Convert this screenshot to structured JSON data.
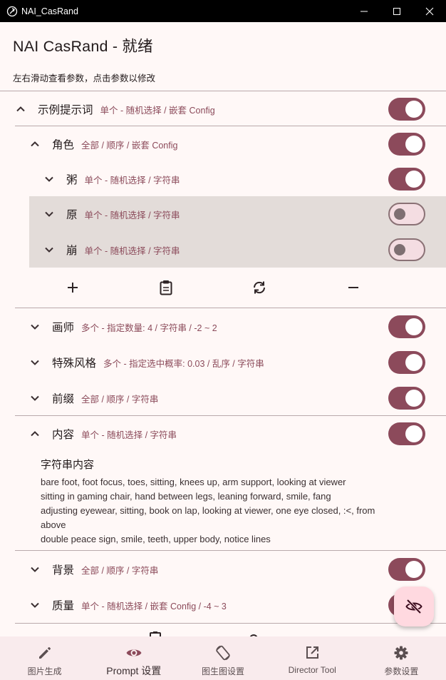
{
  "window": {
    "title": "NAI_CasRand",
    "minimize_icon": "minimize-icon",
    "maximize_icon": "maximize-icon",
    "close_icon": "close-icon"
  },
  "header": {
    "title": "NAI CasRand - 就绪",
    "hint": "左右滑动查看参数，点击参数以修改"
  },
  "tree": {
    "root": {
      "title": "示例提示词",
      "desc": "单个 - 随机选择 / 嵌套 Config",
      "expanded": true,
      "enabled": true
    },
    "role": {
      "title": "角色",
      "desc": "全部 / 顺序 / 嵌套 Config",
      "expanded": true,
      "enabled": true
    },
    "role_children": [
      {
        "title": "粥",
        "desc": "单个 - 随机选择 / 字符串",
        "enabled": true
      },
      {
        "title": "原",
        "desc": "单个 - 随机选择 / 字符串",
        "enabled": false
      },
      {
        "title": "崩",
        "desc": "单个 - 随机选择 / 字符串",
        "enabled": false
      }
    ],
    "actions": [
      "add-icon",
      "paste-icon",
      "sync-icon",
      "remove-icon"
    ],
    "siblings": [
      {
        "title": "画师",
        "desc": "多个 - 指定数量: 4 / 字符串 / -2 ~ 2",
        "enabled": true
      },
      {
        "title": "特殊风格",
        "desc": "多个 - 指定选中概率: 0.03 / 乱序 / 字符串",
        "enabled": true
      },
      {
        "title": "前缀",
        "desc": "全部 / 顺序 / 字符串",
        "enabled": true
      }
    ],
    "content_node": {
      "title": "内容",
      "desc": "单个 - 随机选择 / 字符串",
      "expanded": true,
      "enabled": true
    },
    "content_heading": "字符串内容",
    "content_lines": [
      "bare foot, foot focus, toes, sitting, knees up, arm support, looking at viewer",
      "sitting in gaming chair, hand between legs, leaning forward, smile, fang",
      "adjusting eyewear, sitting, book on lap, looking at viewer, one eye closed, :<, from",
      "above",
      "double peace sign, smile, teeth, upper body, notice lines"
    ],
    "after": [
      {
        "title": "背景",
        "desc": "全部 / 顺序 / 字符串",
        "enabled": true
      },
      {
        "title": "质量",
        "desc": "单个 - 随机选择 / 嵌套 Config / -4 ~ 3",
        "enabled": true
      }
    ]
  },
  "fab": {
    "icon": "eye-off-icon"
  },
  "nav": {
    "items": [
      {
        "label": "图片生成",
        "icon": "pencil-icon",
        "active": false
      },
      {
        "label": "Prompt 设置",
        "icon": "eye-icon",
        "active": true
      },
      {
        "label": "图生图设置",
        "icon": "rotate-icon",
        "active": false
      },
      {
        "label": "Director Tool",
        "icon": "open-in-new-icon",
        "active": false
      },
      {
        "label": "参数设置",
        "icon": "gear-icon",
        "active": false
      }
    ]
  },
  "colors": {
    "accent": "#8c4a5b",
    "desc_text": "#8b4a5a",
    "background": "#fff8f7",
    "nav_background": "#f9ebed",
    "disabled_row": "#e3dcd9",
    "fab_background": "#ffd9e0"
  }
}
